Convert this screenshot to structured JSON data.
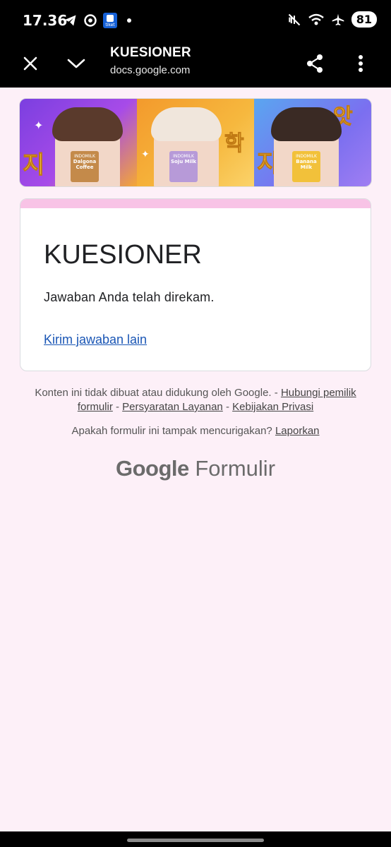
{
  "status_bar": {
    "time": "17.36",
    "battery": "81",
    "tiket_label": "tiket"
  },
  "tab_bar": {
    "title": "KUESIONER",
    "url": "docs.google.com"
  },
  "banner": {
    "korean_text_1": "지",
    "korean_text_2": "학",
    "korean_text_3": "지",
    "korean_text_4": "앗",
    "box_1_label": "Dalgona Coffee",
    "box_2_label": "Soju Milk",
    "box_3_label": "Banana Milk",
    "brand": "INDOMILK"
  },
  "form": {
    "title": "KUESIONER",
    "confirmation": "Jawaban Anda telah direkam.",
    "another_response_link": "Kirim jawaban lain"
  },
  "footer": {
    "disclaimer_text": "Konten ini tidak dibuat atau didukung oleh Google.",
    "sep_1": "-",
    "contact_link": "Hubungi pemilik formulir",
    "sep_2": "-",
    "terms_link": "Persyaratan Layanan",
    "sep_3": "-",
    "privacy_link": "Kebijakan Privasi",
    "report_question": "Apakah formulir ini tampak mencurigakan?",
    "report_link": "Laporkan",
    "brand_google": "Google",
    "brand_forms": "Formulir"
  },
  "colors": {
    "page_bg": "#fdf0f8",
    "accent_stripe": "#f8c3e6",
    "link": "#1a56b5"
  }
}
